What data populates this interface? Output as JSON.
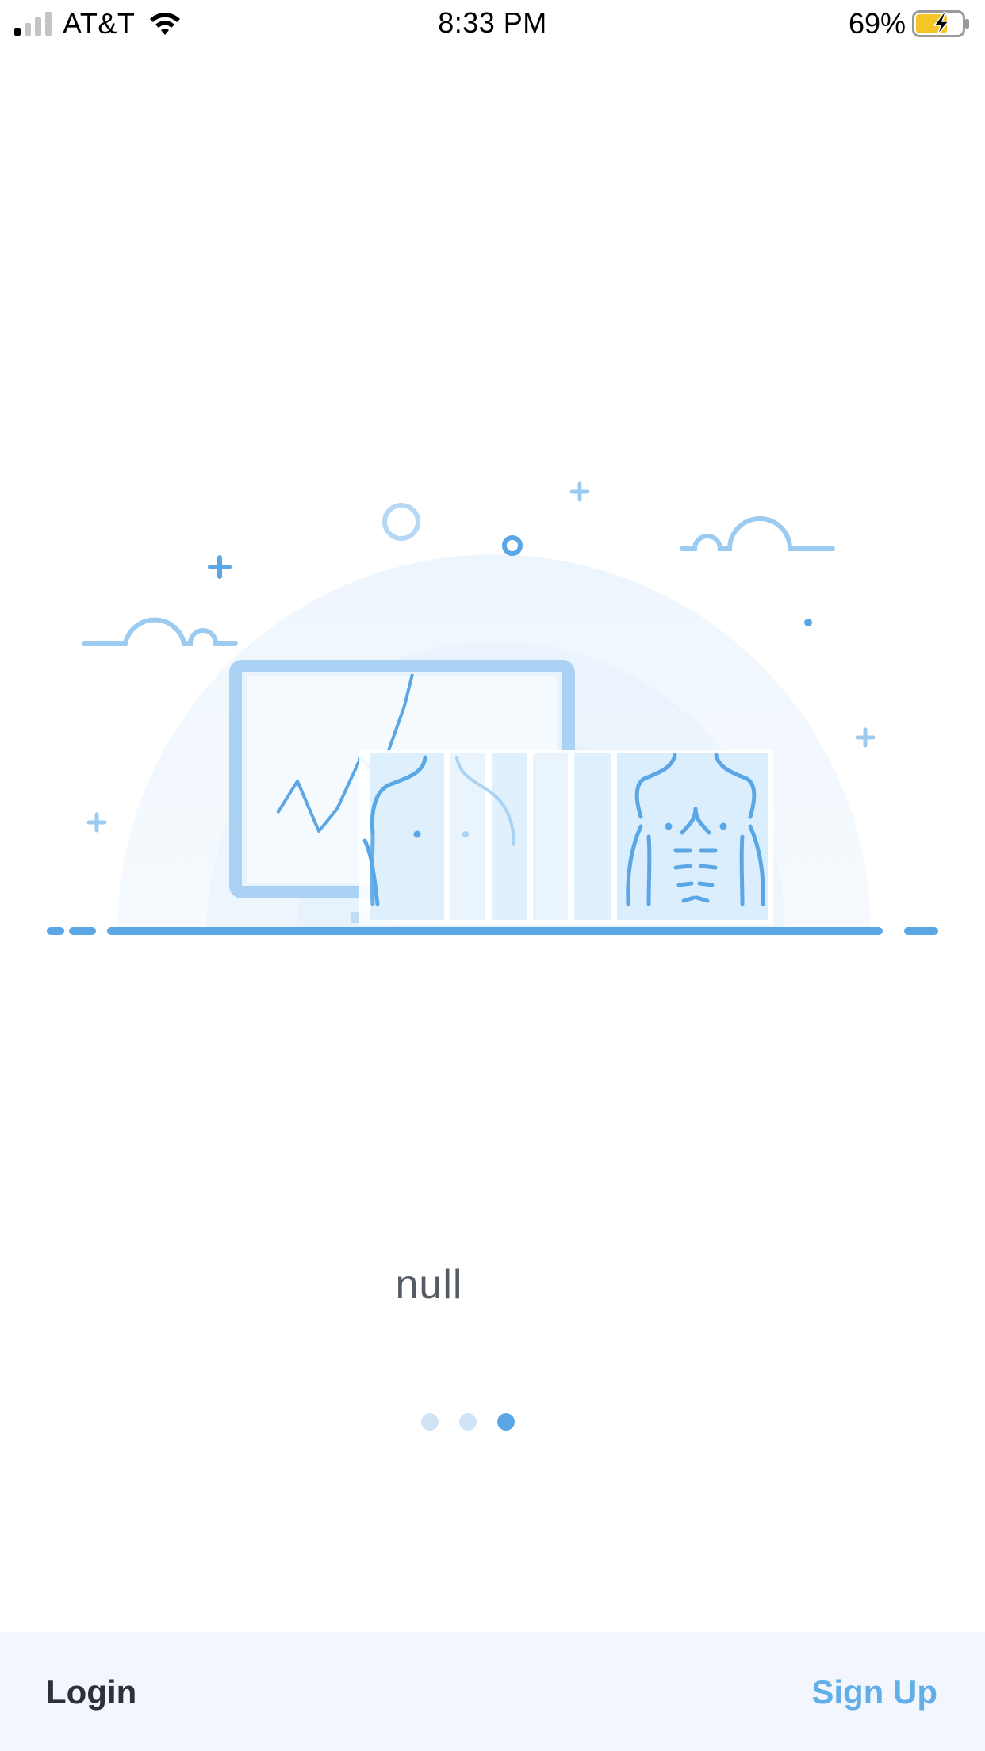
{
  "status_bar": {
    "carrier": "AT&T",
    "time": "8:33 PM",
    "battery_percent": "69%",
    "signal_bars_filled": 1,
    "signal_bars_total": 4,
    "battery_level": 0.69,
    "charging": true,
    "icons": [
      "signal-icon",
      "wifi-icon",
      "battery-charging-icon"
    ]
  },
  "onboarding": {
    "caption": "null",
    "illustration": "monitor-with-body-scan-illustration",
    "page_count": 3,
    "active_page": 3
  },
  "bottom_bar": {
    "login_label": "Login",
    "signup_label": "Sign Up"
  },
  "colors": {
    "accent": "#62aee9",
    "accent_light": "#cfe4f6",
    "bottom_bar_bg": "#f3f6fd",
    "caption_text": "#555b63",
    "login_text": "#2e3238",
    "battery_charging": "#f5c525"
  }
}
